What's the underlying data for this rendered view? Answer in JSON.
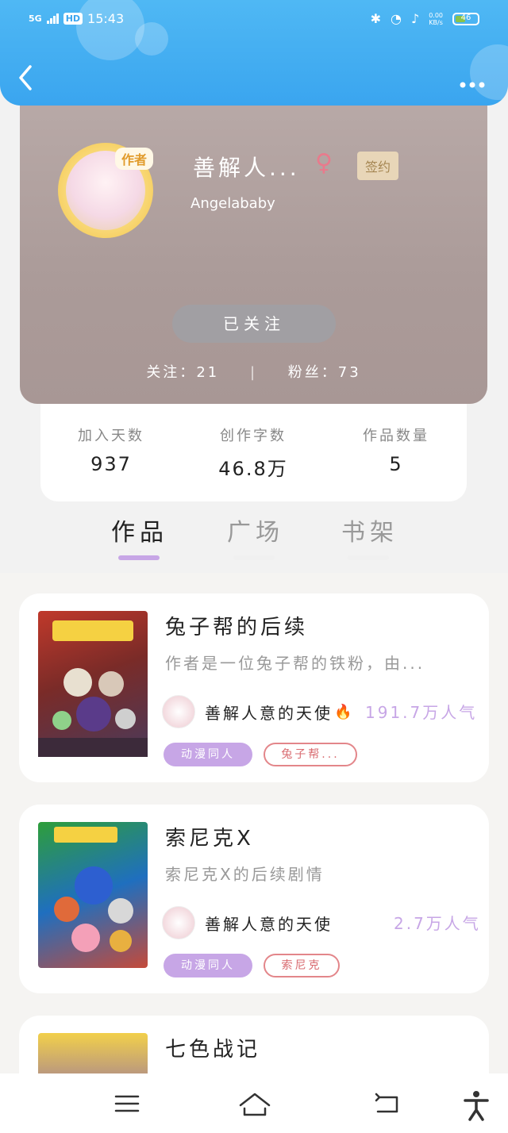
{
  "status_bar": {
    "network": "5G",
    "hd": "HD",
    "time": "15:43",
    "net_speed_top": "0.00",
    "net_speed_bottom": "KB/s",
    "battery_level": "46"
  },
  "header": {
    "back_icon": "chevron-left-icon",
    "more_icon": "more-dots-icon",
    "color": "#3aa5ef"
  },
  "profile": {
    "author_tag": "作者",
    "name": "善解人...",
    "gender_icon": "female-icon",
    "signed_label": "签约",
    "subtitle": "Angelababy",
    "follow_button": "已关注",
    "following_label": "关注：",
    "following_count": "21",
    "separator": "|",
    "fans_label": "粉丝：",
    "fans_count": "73"
  },
  "metrics": [
    {
      "label": "加入天数",
      "value": "937"
    },
    {
      "label": "创作字数",
      "value": "46.8万"
    },
    {
      "label": "作品数量",
      "value": "5"
    }
  ],
  "tabs": [
    {
      "label": "作品",
      "active": true
    },
    {
      "label": "广场",
      "active": false
    },
    {
      "label": "书架",
      "active": false
    }
  ],
  "books": [
    {
      "title": "兔子帮的后续",
      "desc": "作者是一位兔子帮的铁粉，由...",
      "author": "善解人意的天使",
      "popularity": "191.7万人气",
      "tags": [
        "动漫同人",
        "兔子帮..."
      ]
    },
    {
      "title": "索尼克X",
      "desc": "索尼克X的后续剧情",
      "author": "善解人意的天使",
      "popularity": "2.7万人气",
      "tags": [
        "动漫同人",
        "索尼克"
      ]
    },
    {
      "title": "七色战记"
    }
  ],
  "navbar": {
    "menu_icon": "menu-icon",
    "home_icon": "home-icon",
    "back_icon": "back-nav-icon",
    "accessibility_icon": "accessibility-icon"
  },
  "colors": {
    "accent_purple": "#c7a6e6",
    "tag_outline": "#e3868a",
    "header_blue": "#3aa5ef"
  }
}
